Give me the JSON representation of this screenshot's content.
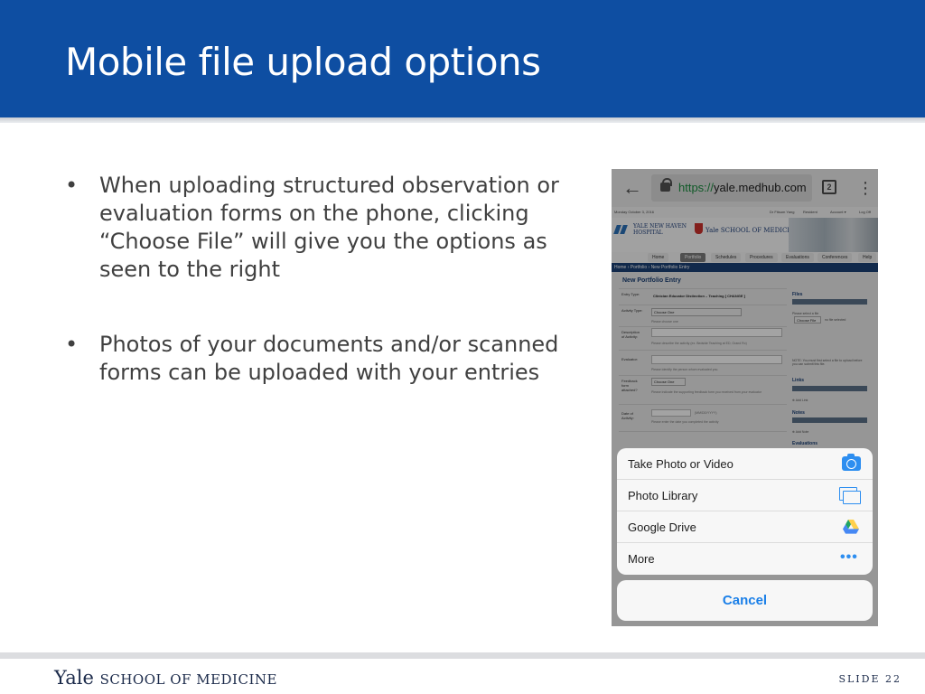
{
  "slide": {
    "title": "Mobile file upload options",
    "bullets": [
      "When uploading structured observation or evaluation forms on the phone, clicking “Choose File” will give you the options as seen to the right",
      "Photos of your documents and/or scanned forms can be uploaded with your entries"
    ],
    "bullet_glyph": "•"
  },
  "phone": {
    "browser": {
      "url_scheme": "https://",
      "url_host": "yale.medhub.com",
      "tab_count": "2",
      "back_glyph": "←",
      "menu_glyph": "⋮"
    },
    "page": {
      "date_line": "Monday October 3, 2016",
      "user_line": "Dr Fitsum Yang",
      "top_links": [
        "Resident",
        "Account ▾",
        "Log Off"
      ],
      "ynhh_line1": "YALE NEW HAVEN",
      "ynhh_line2": "HOSPITAL",
      "yale_line": "Yale SCHOOL OF MEDICINE",
      "nav_items": [
        "Home",
        "Portfolio",
        "Schedules",
        "Procedures",
        "Evaluations",
        "Conferences",
        "Help"
      ],
      "breadcrumb": "Home › Portfolio › New Portfolio Entry",
      "portfolio_title": "New Portfolio Entry",
      "fields": {
        "entry_type_label": "Entry Type:",
        "entry_type_value": "Clinician Educator Distinction – Teaching [ CHANGE ]",
        "activity_type_label": "Activity Type:",
        "activity_type_value": "Choose One",
        "activity_type_hint": "Please choose one",
        "description_label": "Description of Activity:",
        "description_hint": "Please describe the activity (ex. Bedside Teaching at ED, Grand Ro)",
        "evaluator_label": "Evaluator:",
        "evaluator_hint": "Please identify the person whom evaluated you.",
        "feedback_label": "Feedback form attached?",
        "feedback_value": "Choose One",
        "feedback_hint": "Please indicate the supporting feedback form you received from your evaluator",
        "date_label": "Date of Activity:",
        "date_value": "(MM/DD/YYYY)",
        "date_hint": "Please enter the date you completed the activity"
      },
      "sidebar": {
        "files_heading": "Files",
        "choose_file": "Choose File",
        "no_file": "no file selected",
        "please_select": "Please select a file",
        "note": "NOTE: You must first select a file to upload before you can submit this file.",
        "links_heading": "Links",
        "links_add": "⊕ Add Link",
        "notes_heading": "Notes",
        "notes_add": "⊕ Add Note",
        "evaluations_heading": "Evaluations"
      }
    },
    "action_sheet": {
      "options": [
        {
          "label": "Take Photo or Video",
          "icon": "camera-icon"
        },
        {
          "label": "Photo Library",
          "icon": "photo-library-icon"
        },
        {
          "label": "Google Drive",
          "icon": "google-drive-icon"
        },
        {
          "label": "More",
          "icon": "more-icon",
          "glyph": "•••"
        }
      ],
      "cancel": "Cancel"
    },
    "colors": {
      "accent_blue": "#2d8ef0",
      "cancel_blue": "#1a7fe8",
      "drive_green": "#1fa463",
      "drive_yellow": "#ffd04b",
      "drive_blue": "#4688f4"
    }
  },
  "footer": {
    "yale": "Yale",
    "school": "SCHOOL OF MEDICINE",
    "slide_label": "SLIDE",
    "slide_number": "22"
  },
  "colors": {
    "header_blue": "#0e4ea2",
    "body_text": "#404040",
    "footer_navy": "#1b2a4a"
  }
}
